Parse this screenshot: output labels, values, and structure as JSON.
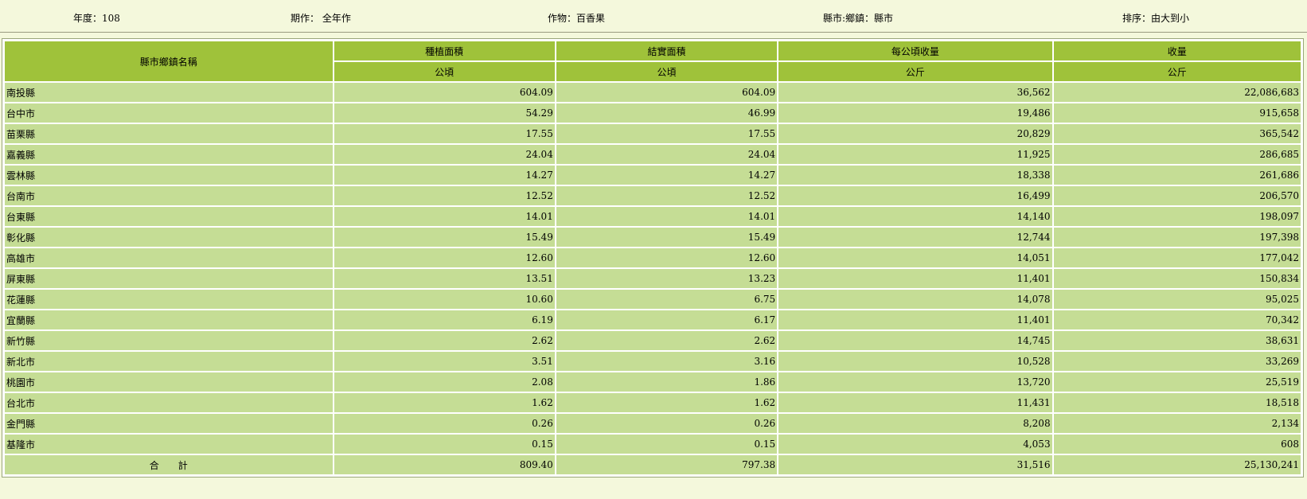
{
  "filters": {
    "year": "年度：108",
    "period": "期作： 全年作",
    "crop": "作物：百香果",
    "region": "縣市:鄉鎮：縣市",
    "sort": "排序：由大到小"
  },
  "table": {
    "headers": {
      "name": "縣市鄉鎮名稱",
      "planted_area": "種植面積",
      "harvested_area": "結實面積",
      "yield_per_ha": "每公頃收量",
      "production": "收量"
    },
    "units": {
      "planted_area": "公頃",
      "harvested_area": "公頃",
      "yield_per_ha": "公斤",
      "production": "公斤"
    },
    "rows": [
      {
        "name": "南投縣",
        "planted_area": "604.09",
        "harvested_area": "604.09",
        "yield_per_ha": "36,562",
        "production": "22,086,683"
      },
      {
        "name": "台中市",
        "planted_area": "54.29",
        "harvested_area": "46.99",
        "yield_per_ha": "19,486",
        "production": "915,658"
      },
      {
        "name": "苗栗縣",
        "planted_area": "17.55",
        "harvested_area": "17.55",
        "yield_per_ha": "20,829",
        "production": "365,542"
      },
      {
        "name": "嘉義縣",
        "planted_area": "24.04",
        "harvested_area": "24.04",
        "yield_per_ha": "11,925",
        "production": "286,685"
      },
      {
        "name": "雲林縣",
        "planted_area": "14.27",
        "harvested_area": "14.27",
        "yield_per_ha": "18,338",
        "production": "261,686"
      },
      {
        "name": "台南市",
        "planted_area": "12.52",
        "harvested_area": "12.52",
        "yield_per_ha": "16,499",
        "production": "206,570"
      },
      {
        "name": "台東縣",
        "planted_area": "14.01",
        "harvested_area": "14.01",
        "yield_per_ha": "14,140",
        "production": "198,097"
      },
      {
        "name": "彰化縣",
        "planted_area": "15.49",
        "harvested_area": "15.49",
        "yield_per_ha": "12,744",
        "production": "197,398"
      },
      {
        "name": "高雄市",
        "planted_area": "12.60",
        "harvested_area": "12.60",
        "yield_per_ha": "14,051",
        "production": "177,042"
      },
      {
        "name": "屏東縣",
        "planted_area": "13.51",
        "harvested_area": "13.23",
        "yield_per_ha": "11,401",
        "production": "150,834"
      },
      {
        "name": "花蓮縣",
        "planted_area": "10.60",
        "harvested_area": "6.75",
        "yield_per_ha": "14,078",
        "production": "95,025"
      },
      {
        "name": "宜蘭縣",
        "planted_area": "6.19",
        "harvested_area": "6.17",
        "yield_per_ha": "11,401",
        "production": "70,342"
      },
      {
        "name": "新竹縣",
        "planted_area": "2.62",
        "harvested_area": "2.62",
        "yield_per_ha": "14,745",
        "production": "38,631"
      },
      {
        "name": "新北市",
        "planted_area": "3.51",
        "harvested_area": "3.16",
        "yield_per_ha": "10,528",
        "production": "33,269"
      },
      {
        "name": "桃園市",
        "planted_area": "2.08",
        "harvested_area": "1.86",
        "yield_per_ha": "13,720",
        "production": "25,519"
      },
      {
        "name": "台北市",
        "planted_area": "1.62",
        "harvested_area": "1.62",
        "yield_per_ha": "11,431",
        "production": "18,518"
      },
      {
        "name": "金門縣",
        "planted_area": "0.26",
        "harvested_area": "0.26",
        "yield_per_ha": "8,208",
        "production": "2,134"
      },
      {
        "name": "基隆市",
        "planted_area": "0.15",
        "harvested_area": "0.15",
        "yield_per_ha": "4,053",
        "production": "608"
      }
    ],
    "total": {
      "label": "合　　計",
      "planted_area": "809.40",
      "harvested_area": "797.38",
      "yield_per_ha": "31,516",
      "production": "25,130,241"
    }
  }
}
